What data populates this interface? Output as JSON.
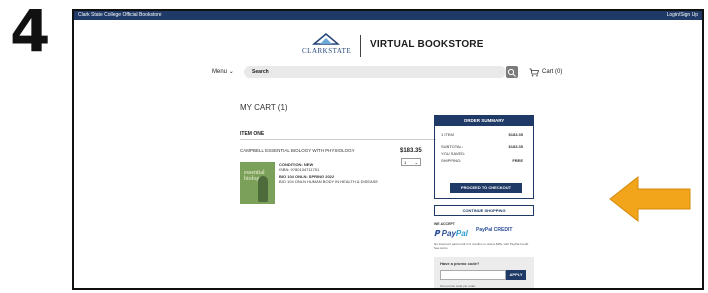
{
  "step_number": "4",
  "topbar": {
    "left": "Clark State College Official Bookstore",
    "right": "Login/Sign Up"
  },
  "header": {
    "logo_text": "CLARKSTATE",
    "title": "VIRTUAL BOOKSTORE"
  },
  "nav": {
    "menu_label": "Menu",
    "search_placeholder": "Search",
    "cart_label": "Cart (0)"
  },
  "cart": {
    "heading": "MY CART (1)",
    "item_heading": "ITEM ONE",
    "item": {
      "name": "CAMPBELL ESSENTIAL BIOLOGY WITH PHYSIOLOGY",
      "price": "$183.35",
      "quantity": "1",
      "cover_text": "essential biology",
      "condition": "CONDITION: NEW",
      "isbn": "ISBN: 9780134711751",
      "course": "BIO 104 ONLN: SPRING 2022",
      "course_desc": "BIO 104 ONLN HUMAN BODY IN HEALTH & DISEASE"
    }
  },
  "summary": {
    "header": "ORDER SUMMARY",
    "item_count_label": "1 ITEM",
    "item_count_value": "$183.35",
    "subtotal_label": "SUBTOTAL:",
    "subtotal_value": "$183.35",
    "saved_label": "YOU SAVED:",
    "saved_value": "",
    "shipping_label": "SHIPPING:",
    "shipping_value": "FREE",
    "checkout_button": "PROCEED TO CHECKOUT",
    "continue_button": "CONTINUE SHOPPING",
    "we_accept": "WE ACCEPT",
    "paypal_pay": "Pay",
    "paypal_pal": "Pal",
    "paypal_credit": "PayPal CREDIT",
    "paypal_note": "No Interest if paid in full in 6 months on orders $99+ with PayPal Credit. See terms.",
    "promo_title": "Have a promo code?",
    "promo_button": "APPLY",
    "promo_note": "One promo code per order."
  },
  "colors": {
    "navy": "#1f3a66",
    "arrow": "#f2a51a"
  }
}
